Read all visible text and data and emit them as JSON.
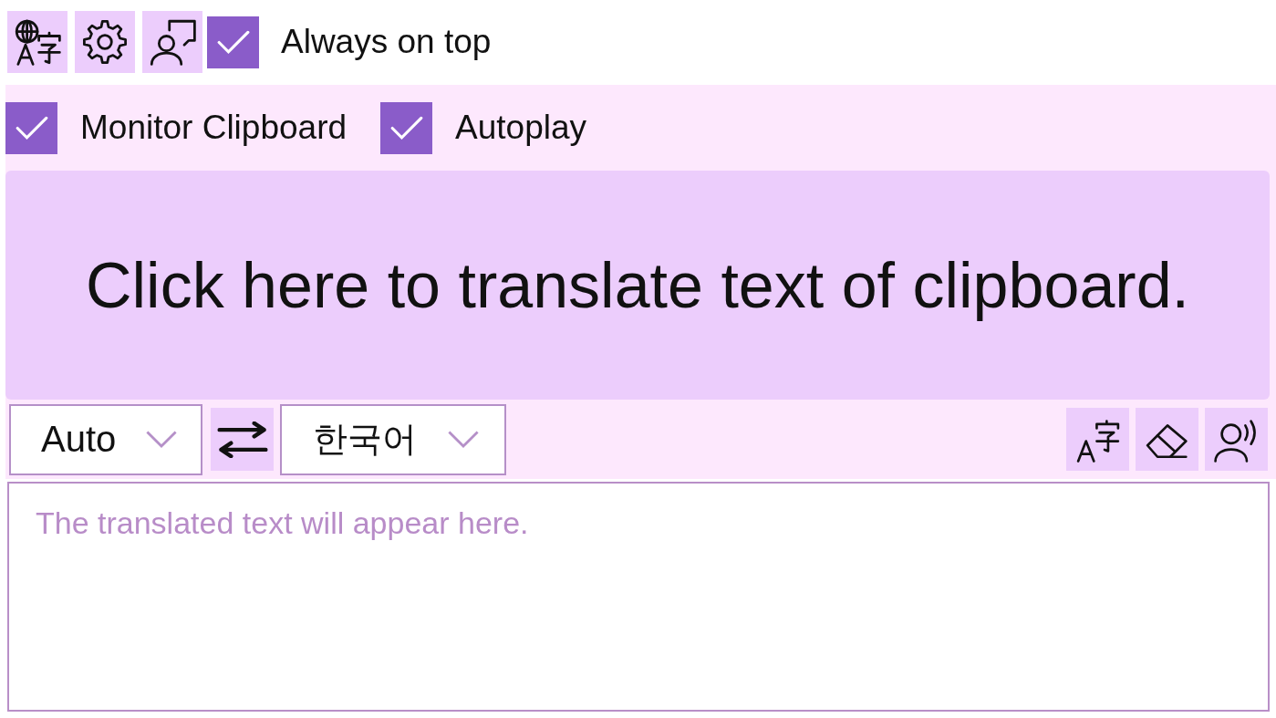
{
  "toolbar": {
    "always_on_top": {
      "label": "Always on top",
      "checked": true
    }
  },
  "options": [
    {
      "label": "Monitor Clipboard",
      "checked": true
    },
    {
      "label": "Autoplay",
      "checked": true
    }
  ],
  "translate_panel": {
    "label": "Click here to translate text of clipboard."
  },
  "language_bar": {
    "source": {
      "value": "Auto"
    },
    "target": {
      "value": "한국어"
    }
  },
  "output": {
    "placeholder": "The translated text will appear here."
  }
}
